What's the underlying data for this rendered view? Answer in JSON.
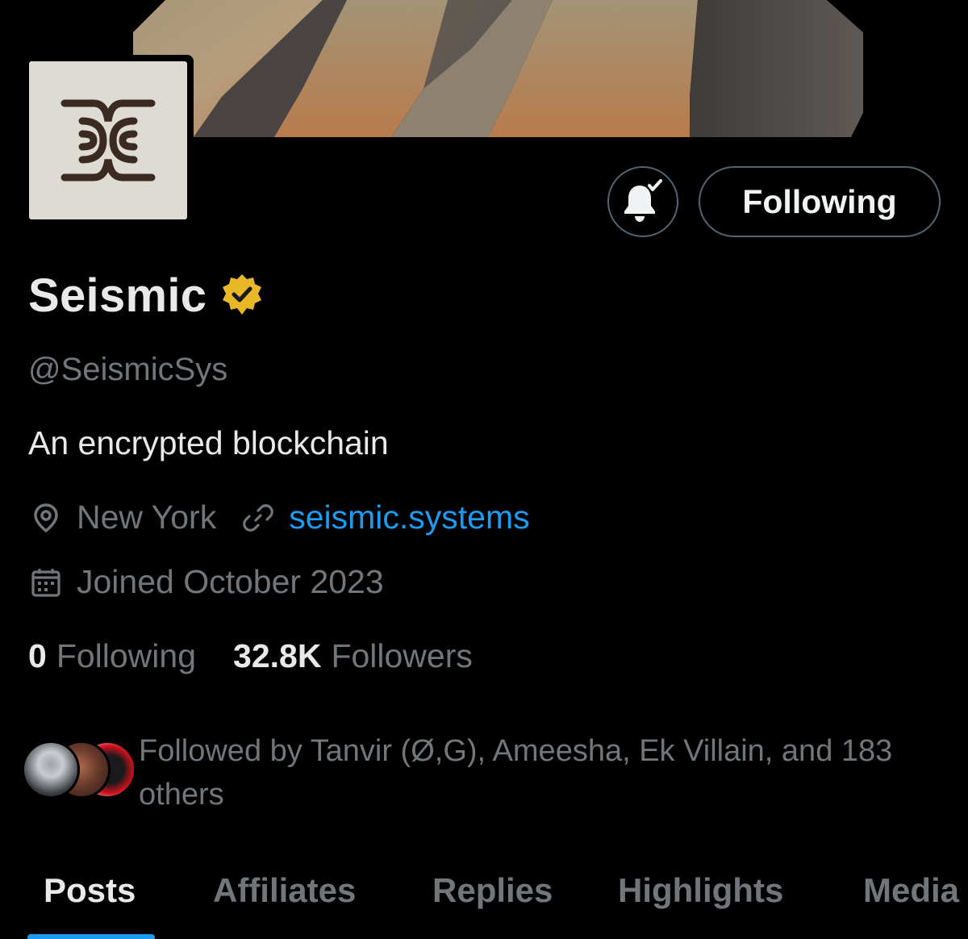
{
  "profile": {
    "display_name": "Seismic",
    "handle": "@SeismicSys",
    "bio": "An encrypted blockchain",
    "location": "New York",
    "website": "seismic.systems",
    "joined": "Joined October 2023"
  },
  "actions": {
    "follow_label": "Following",
    "notify_icon": "bell-check-icon"
  },
  "stats": {
    "following_count": "0",
    "following_label": "Following",
    "followers_count": "32.8K",
    "followers_label": "Followers"
  },
  "followed_by": {
    "text": "Followed by Tanvir (Ø,G), Ameesha, Ek Villain, and 183 others"
  },
  "tabs": [
    {
      "label": "Posts",
      "active": true
    },
    {
      "label": "Affiliates",
      "active": false
    },
    {
      "label": "Replies",
      "active": false
    },
    {
      "label": "Highlights",
      "active": false
    },
    {
      "label": "Media",
      "active": false
    }
  ],
  "colors": {
    "background": "#000000",
    "text_primary": "#e7e9ea",
    "text_secondary": "#71767b",
    "accent": "#1d9bf0",
    "verified_gold": "#e8b829",
    "button_border": "#536471",
    "avatar_bg": "#dedbd4",
    "logo_brown": "#3b2a20"
  },
  "icons": {
    "verified": "verified-badge-icon",
    "location": "location-pin-icon",
    "link": "link-icon",
    "calendar": "calendar-icon"
  }
}
